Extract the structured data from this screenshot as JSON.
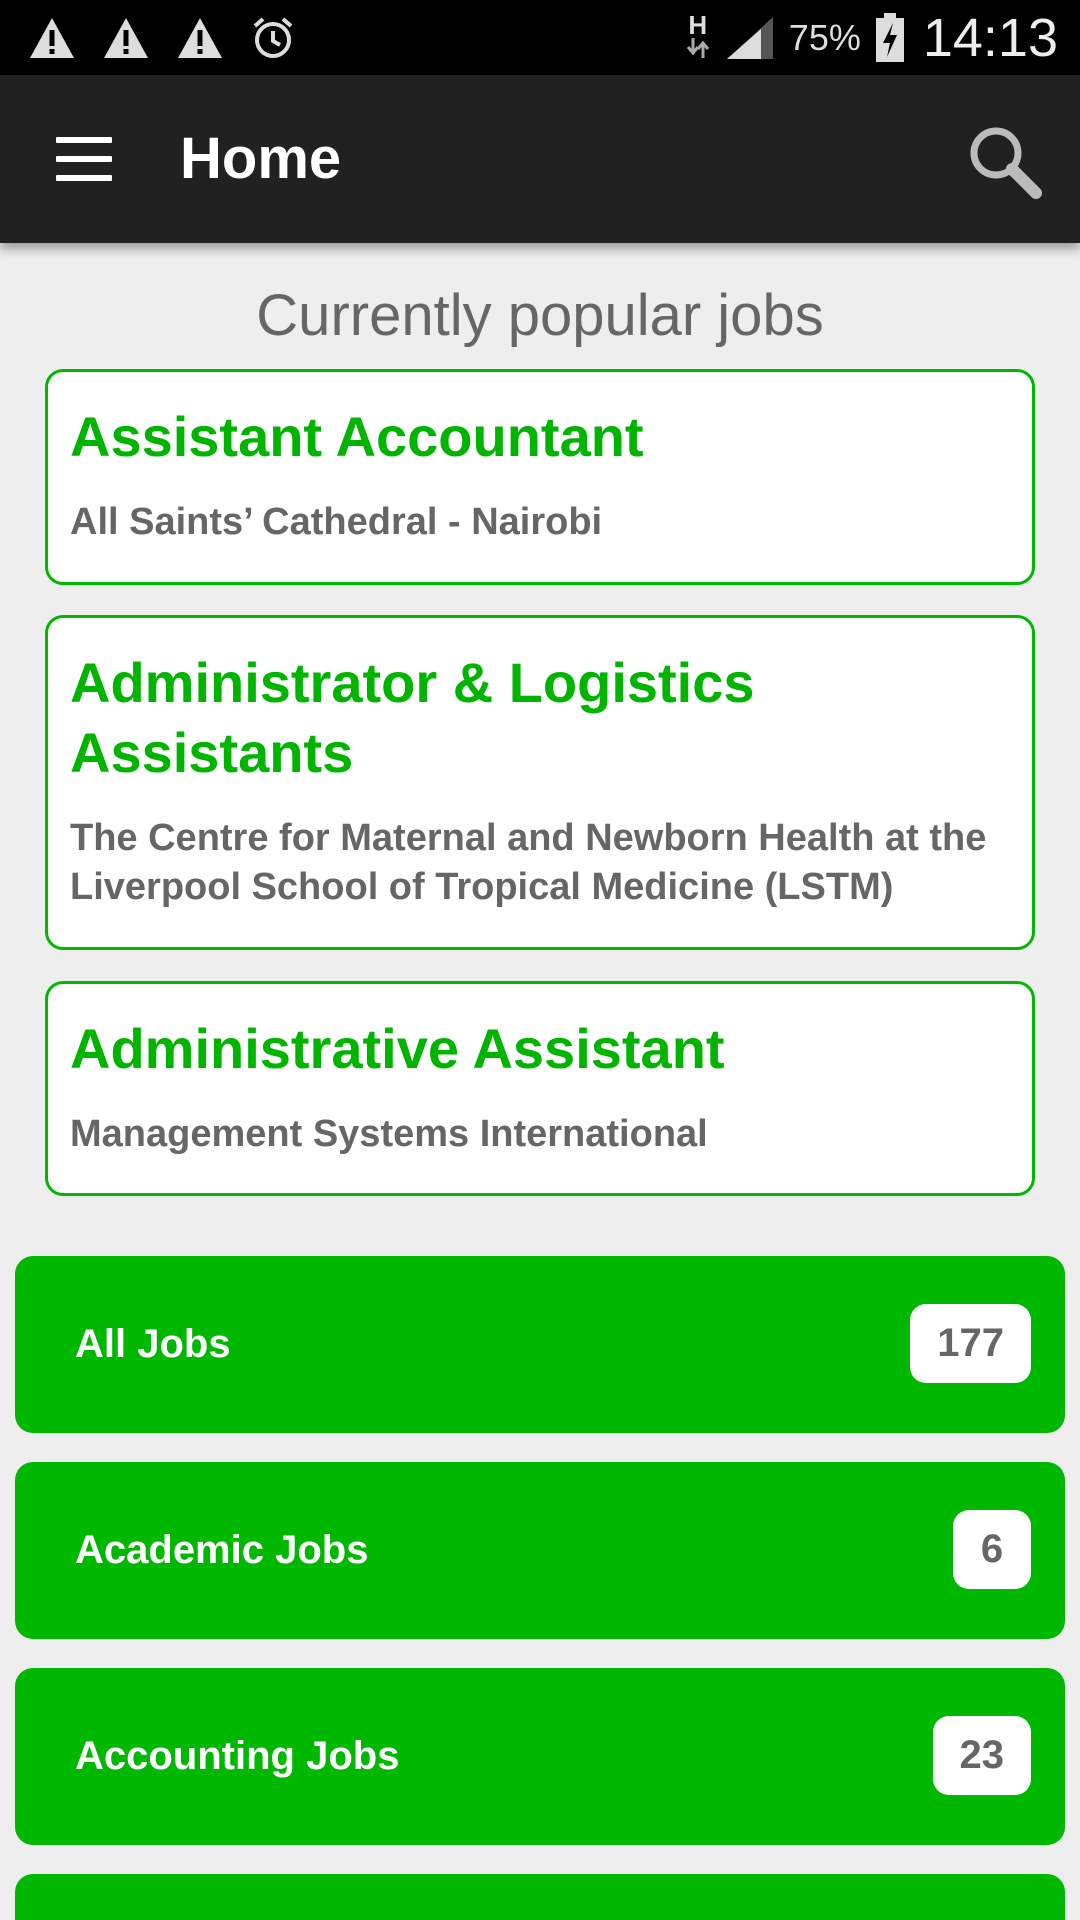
{
  "status_bar": {
    "left_icons": [
      "warning-icon",
      "warning-icon",
      "warning-icon",
      "alarm-clock-icon"
    ],
    "network_type": "H",
    "battery_percent": "75%",
    "time": "14:13"
  },
  "app_bar": {
    "title": "Home",
    "menu_icon": "hamburger-menu-icon",
    "search_icon": "search-icon",
    "background": "#212121"
  },
  "popular": {
    "heading": "Currently popular jobs",
    "jobs": [
      {
        "title": "Assistant Accountant",
        "organization": "All Saints’ Cathedral - Nairobi"
      },
      {
        "title": "Administrator & Logistics Assistants",
        "organization": "The Centre for Maternal and Newborn Health at the Liverpool School of Tropical Medicine (LSTM)"
      },
      {
        "title": "Administrative Assistant",
        "organization": "Management Systems International"
      }
    ]
  },
  "categories": [
    {
      "label": "All Jobs",
      "count": "177"
    },
    {
      "label": "Academic Jobs",
      "count": "6"
    },
    {
      "label": "Accounting Jobs",
      "count": "23"
    },
    {
      "label": "",
      "count": ""
    }
  ],
  "colors": {
    "accent_green": "#00b800",
    "page_background": "#eeeeee",
    "secondary_text": "#666666"
  }
}
